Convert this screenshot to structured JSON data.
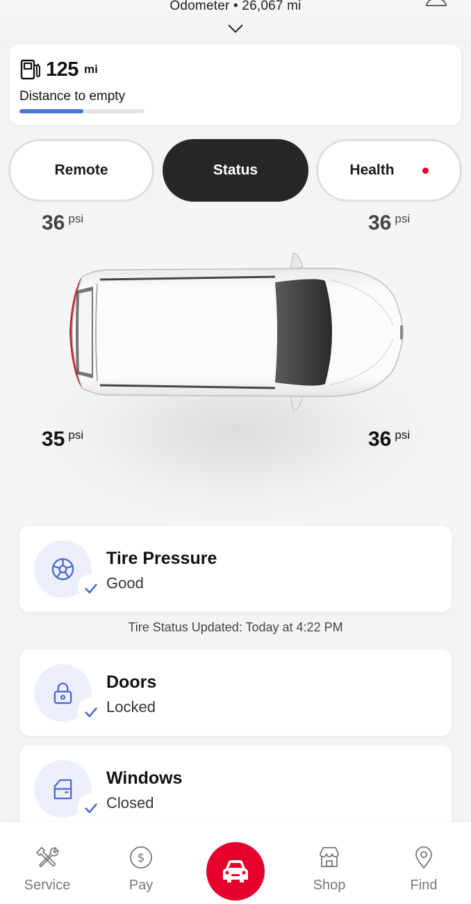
{
  "header": {
    "odometer_label": "Odometer",
    "odometer_separator": "•",
    "odometer_value": "26,067 mi",
    "odometer_text": "Odometer • 26,067 mi",
    "expand_icon": "chevron-down-icon",
    "profile_icon": "person-icon"
  },
  "fuel": {
    "icon": "fuel-pump-icon",
    "value": "125",
    "unit": "mi",
    "label": "Distance to empty",
    "level_percent": 51,
    "bar_color": "#4a74dd"
  },
  "tabs": [
    {
      "label": "Remote",
      "active": false
    },
    {
      "label": "Status",
      "active": true
    },
    {
      "label": "Health",
      "active": false,
      "alert_dot": true,
      "alert_color": "#e4002b"
    }
  ],
  "tires": {
    "front_left": {
      "value": "36",
      "unit": "psi"
    },
    "front_right": {
      "value": "36",
      "unit": "psi"
    },
    "rear_left": {
      "value": "35",
      "unit": "psi"
    },
    "rear_right": {
      "value": "36",
      "unit": "psi"
    }
  },
  "status_cards": [
    {
      "title": "Tire Pressure",
      "status": "Good",
      "icon": "tire-icon",
      "ok": true
    },
    {
      "title": "Doors",
      "status": "Locked",
      "icon": "lock-icon",
      "ok": true
    },
    {
      "title": "Windows",
      "status": "Closed",
      "icon": "car-window-icon",
      "ok": true
    }
  ],
  "tire_updated": "Tire Status Updated:  Today at 4:22 PM",
  "bottom_nav": [
    {
      "label": "Service",
      "icon": "tools-icon"
    },
    {
      "label": "Pay",
      "icon": "dollar-icon"
    },
    {
      "label": "",
      "icon": "vehicle-icon",
      "active": true
    },
    {
      "label": "Shop",
      "icon": "storefront-icon"
    },
    {
      "label": "Find",
      "icon": "location-pin-icon"
    }
  ],
  "colors": {
    "accent_red": "#e4002b",
    "accent_blue": "#4a74dd",
    "active_tab": "#262626",
    "icon_circle_bg": "#edf0fb"
  }
}
